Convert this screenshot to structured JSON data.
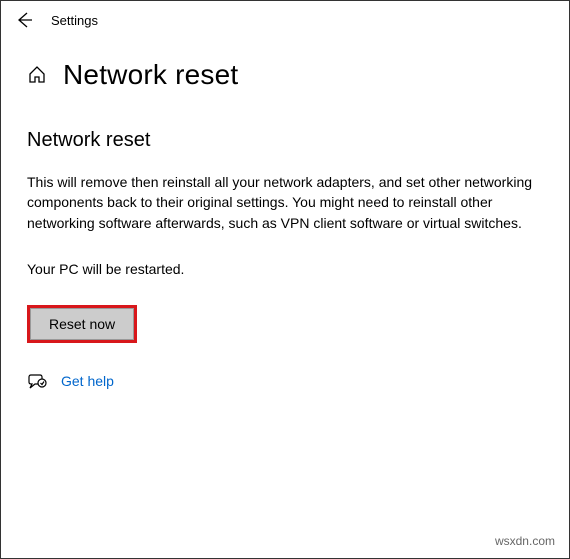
{
  "header": {
    "title": "Settings"
  },
  "page": {
    "heading": "Network reset",
    "section_heading": "Network reset",
    "description": "This will remove then reinstall all your network adapters, and set other networking components back to their original settings. You might need to reinstall other networking software afterwards, such as VPN client software or virtual switches.",
    "restart_note": "Your PC will be restarted.",
    "reset_button_label": "Reset now",
    "help_link_label": "Get help"
  },
  "watermark": "wsxdn.com",
  "icons": {
    "back": "arrow-left",
    "home": "house",
    "help": "chat-bubble"
  },
  "colors": {
    "highlight_border": "#d8171b",
    "link": "#0066cc",
    "button_bg": "#cccccc"
  }
}
